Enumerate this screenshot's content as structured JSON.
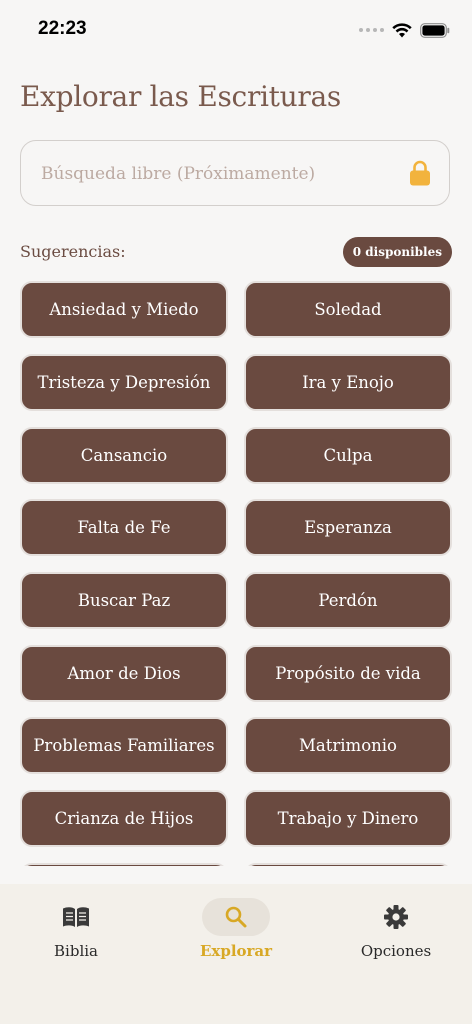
{
  "status_bar": {
    "time": "22:23"
  },
  "page": {
    "title": "Explorar las Escrituras"
  },
  "search": {
    "placeholder": "Búsqueda libre (Próximamente)"
  },
  "suggestions": {
    "label": "Sugerencias:",
    "badge": "0 disponibles",
    "items": [
      "Ansiedad y Miedo",
      "Soledad",
      "Tristeza y Depresión",
      "Ira y Enojo",
      "Cansancio",
      "Culpa",
      "Falta de Fe",
      "Esperanza",
      "Buscar Paz",
      "Perdón",
      "Amor de Dios",
      "Propósito de vida",
      "Problemas Familiares",
      "Matrimonio",
      "Crianza de Hijos",
      "Trabajo y Dinero"
    ]
  },
  "nav": {
    "items": [
      {
        "label": "Biblia",
        "icon": "book-icon"
      },
      {
        "label": "Explorar",
        "icon": "search-icon",
        "active": true
      },
      {
        "label": "Opciones",
        "icon": "gear-icon"
      }
    ]
  },
  "colors": {
    "accent": "#d8a825",
    "chip": "#6a4a40",
    "title": "#7a5a4d"
  }
}
